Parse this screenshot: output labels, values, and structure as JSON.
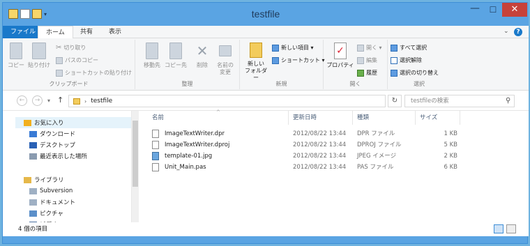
{
  "window": {
    "title": "testfile",
    "min": "—",
    "max": "☐",
    "close": "✕"
  },
  "qat": [
    "folder-icon",
    "properties-icon",
    "new-folder-icon",
    "customize-icon"
  ],
  "tabs": [
    {
      "label": "ファイル"
    },
    {
      "label": "ホーム"
    },
    {
      "label": "共有"
    },
    {
      "label": "表示"
    }
  ],
  "ribbon": {
    "clipboard": {
      "group": "クリップボード",
      "copy": "コピー",
      "paste": "貼り付け",
      "cut": "切り取り",
      "copy_path": "パスのコピー",
      "paste_shortcut": "ショートカットの貼り付け"
    },
    "organize": {
      "group": "整理",
      "move_to": "移動先",
      "copy_to": "コピー先",
      "delete": "削除",
      "rename_1": "名前の",
      "rename_2": "変更"
    },
    "new": {
      "group": "新規",
      "new_folder_1": "新しい",
      "new_folder_2": "フォルダー",
      "new_item": "新しい項目 ▾",
      "shortcut": "ショートカット ▾"
    },
    "open": {
      "group": "開く",
      "properties": "プロパティ",
      "open": "開く ▾",
      "edit": "編集",
      "history": "履歴"
    },
    "select": {
      "group": "選択",
      "select_all": "すべて選択",
      "select_none": "選択解除",
      "invert": "選択の切り替え"
    }
  },
  "nav": {
    "back": "←",
    "forward": "→",
    "up": "↑",
    "path": "testfile",
    "search_placeholder": "testfileの検索"
  },
  "tree": [
    {
      "label": "お気に入り",
      "icon": "star-icon",
      "color": "#f2b01e"
    },
    {
      "label": "ダウンロード",
      "icon": "download-icon",
      "color": "#3a7bd5"
    },
    {
      "label": "デスクトップ",
      "icon": "desktop-icon",
      "color": "#2a62b5"
    },
    {
      "label": "最近表示した場所",
      "icon": "recent-icon",
      "color": "#8a9bb0"
    },
    {
      "label": "ライブラリ",
      "icon": "library-icon",
      "color": "#e6b84a"
    },
    {
      "label": "Subversion",
      "icon": "library-folder-icon",
      "color": "#9fb0c4"
    },
    {
      "label": "ドキュメント",
      "icon": "documents-icon",
      "color": "#9fb0c4"
    },
    {
      "label": "ピクチャ",
      "icon": "pictures-icon",
      "color": "#5b8fc9"
    },
    {
      "label": "ビデオ",
      "icon": "videos-icon",
      "color": "#4a6fa0"
    }
  ],
  "columns": {
    "name": "名前",
    "date": "更新日時",
    "type": "種類",
    "size": "サイズ"
  },
  "files": [
    {
      "name": "ImageTextWriter.dpr",
      "date": "2012/08/22 13:44",
      "type": "DPR ファイル",
      "size": "1 KB"
    },
    {
      "name": "ImageTextWriter.dproj",
      "date": "2012/08/22 13:44",
      "type": "DPROJ ファイル",
      "size": "5 KB"
    },
    {
      "name": "template-01.jpg",
      "date": "2012/08/22 13:44",
      "type": "JPEG イメージ",
      "size": "2 KB"
    },
    {
      "name": "Unit_Main.pas",
      "date": "2012/08/22 13:44",
      "type": "PAS ファイル",
      "size": "6 KB"
    }
  ],
  "status": {
    "count": "4 個の項目"
  }
}
